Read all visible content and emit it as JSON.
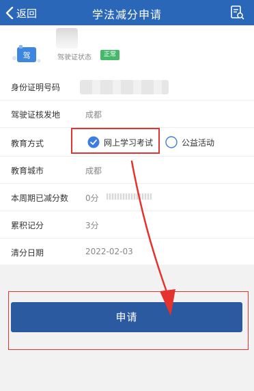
{
  "nav": {
    "back_label": "返回",
    "title": "学法减分申请",
    "back_icon": "chevron-left-icon",
    "doc_icon": "document-search-icon"
  },
  "license": {
    "icon_char": "驾",
    "status_label": "驾驶证状态",
    "status_badge": "正常"
  },
  "fields": {
    "id_number": {
      "label": "身份证明号码"
    },
    "issue_place": {
      "label": "驾驶证核发地",
      "value": "成都"
    },
    "edu_method": {
      "label": "教育方式",
      "options": [
        {
          "label": "网上学习考试",
          "selected": true
        },
        {
          "label": "公益活动",
          "selected": false
        }
      ]
    },
    "edu_city": {
      "label": "教育城市",
      "value": "成都"
    },
    "period_reduced": {
      "label": "本周期已减分数",
      "value": "0分"
    },
    "accumulated": {
      "label": "累积记分",
      "value": "3分"
    },
    "clear_date": {
      "label": "清分日期",
      "value": "2022-02-03"
    }
  },
  "actions": {
    "submit_label": "申请"
  },
  "colors": {
    "primary": "#2a67b8",
    "button": "#2b5aa1",
    "status_green": "#45b86a",
    "annotation_red": "#e5322d"
  }
}
